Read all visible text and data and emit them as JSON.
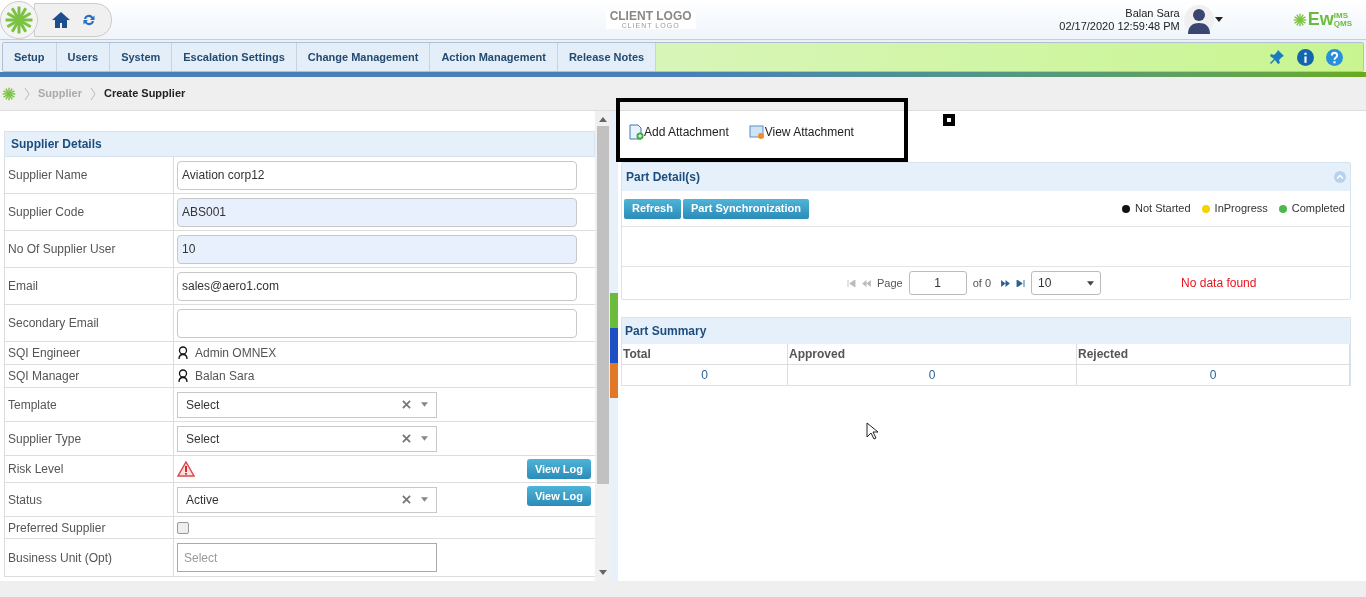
{
  "header": {
    "client_logo": "CLIENT LOGO",
    "client_logo_sub": "CLIENT LOGO",
    "user_name": "Balan Sara",
    "datetime": "02/17/2020 12:59:48 PM",
    "brand": "Ew",
    "brand_sup": "IMS",
    "brand_sub": "QMS"
  },
  "nav": [
    {
      "label": "Setup"
    },
    {
      "label": "Users"
    },
    {
      "label": "System"
    },
    {
      "label": "Escalation Settings"
    },
    {
      "label": "Change Management"
    },
    {
      "label": "Action Management"
    },
    {
      "label": "Release Notes"
    }
  ],
  "breadcrumb": [
    {
      "label": "Supplier",
      "current": false
    },
    {
      "label": "Create Supplier",
      "current": true
    }
  ],
  "supplier_details": {
    "title": "Supplier Details",
    "rows": [
      {
        "label": "Supplier Name",
        "kind": "text",
        "value": "Aviation corp12",
        "highlighted": false
      },
      {
        "label": "Supplier Code",
        "kind": "text",
        "value": "ABS001",
        "highlighted": true
      },
      {
        "label": "No Of Supplier User",
        "kind": "text",
        "value": "10",
        "highlighted": true
      },
      {
        "label": "Email",
        "kind": "text",
        "value": "sales@aero1.com",
        "highlighted": false
      },
      {
        "label": "Secondary Email",
        "kind": "text",
        "highlighted": false
      },
      {
        "label": "SQI Engineer",
        "kind": "person",
        "value": "Admin OMNEX"
      },
      {
        "label": "SQI Manager",
        "kind": "person",
        "value": "Balan Sara"
      },
      {
        "label": "Template",
        "kind": "select",
        "value": "Select"
      },
      {
        "label": "Supplier Type",
        "kind": "select",
        "value": "Select"
      },
      {
        "label": "Risk Level",
        "kind": "risk",
        "button": "View Log"
      },
      {
        "label": "Status",
        "kind": "select",
        "value": "Active",
        "button": "View Log"
      },
      {
        "label": "Preferred Supplier",
        "kind": "checkbox",
        "checked": false
      },
      {
        "label": "Business Unit (Opt)",
        "kind": "placeholder",
        "placeholder": "Select"
      }
    ]
  },
  "attachments": [
    {
      "label": "Add Attachment",
      "kind": "add"
    },
    {
      "label": "View Attachment",
      "kind": "view"
    }
  ],
  "part_details": {
    "title": "Part Detail(s)",
    "buttons": [
      "Refresh",
      "Part Synchronization"
    ],
    "legend": [
      {
        "label": "Not Started",
        "color": "#111111"
      },
      {
        "label": "InProgress",
        "color": "#f2d500"
      },
      {
        "label": "Completed",
        "color": "#4cb850"
      }
    ],
    "pager": {
      "page_label": "Page",
      "page": "1",
      "of": "of 0",
      "page_size": "10"
    },
    "message": "No data found"
  },
  "part_summary": {
    "title": "Part Summary",
    "columns": [
      "Total",
      "Approved",
      "Rejected"
    ],
    "values": [
      "0",
      "0",
      "0"
    ]
  }
}
